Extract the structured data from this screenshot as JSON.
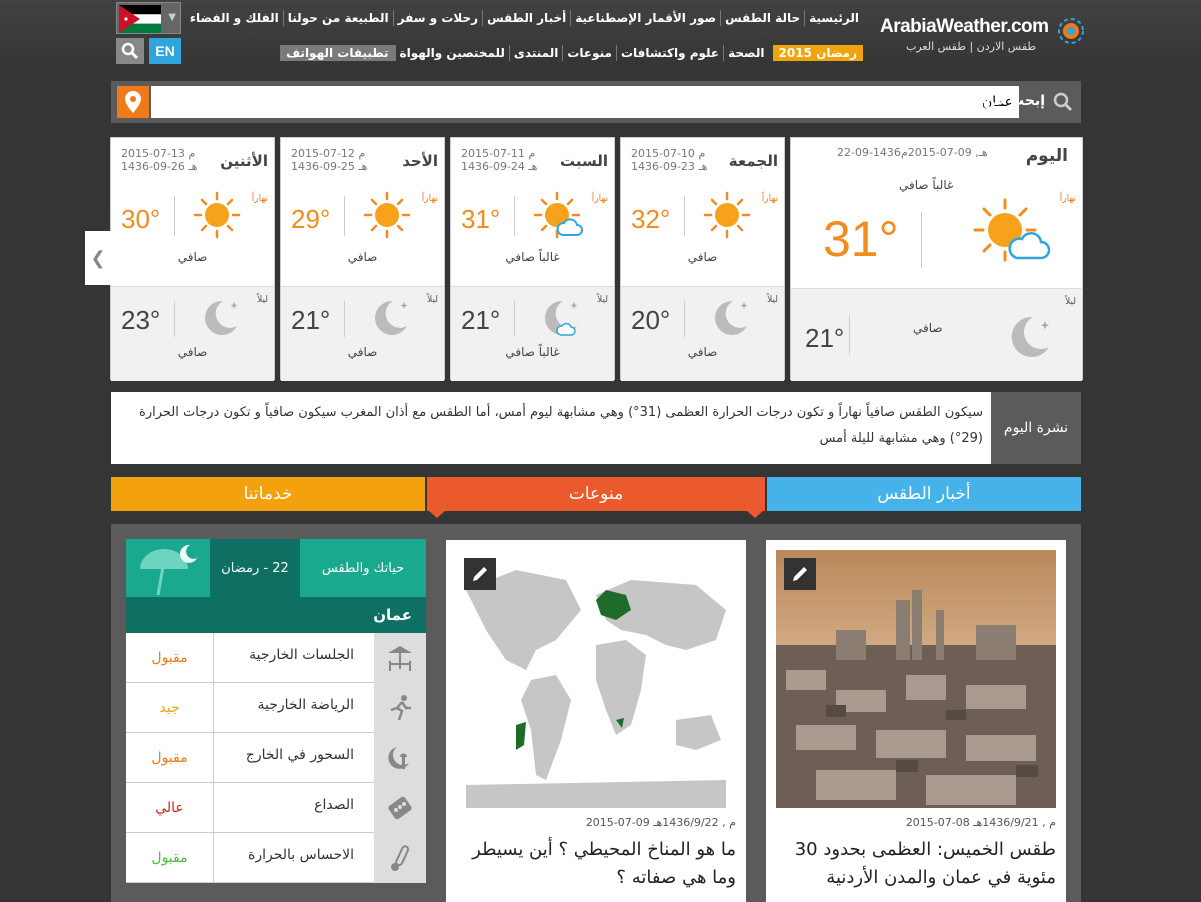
{
  "header": {
    "logo_name": "ArabiaWeather.com",
    "logo_sub": "طقس الاردن | طقس العرب",
    "lang": "EN",
    "nav_primary": [
      "الرئيسية",
      "حالة الطقس",
      "صور الأقمار الإصطناعية",
      "أخبار الطقس",
      "رحلات و سفر",
      "الطبيعة من حولنا",
      "الفلك و الفضاء"
    ],
    "nav_secondary": [
      "رمضان 2015",
      "الصحة",
      "علوم واكتشافات",
      "منوعات",
      "المنتدى",
      "للمختصين والهواة",
      "تطبيقات الهواتف"
    ]
  },
  "search": {
    "label": "إبحث عن منطقتك",
    "value": "عمان"
  },
  "today": {
    "day": "اليوم",
    "date": "22-09-1436هـ, 09-07-2015م",
    "summary": "غالباً صافي",
    "day_label": "نهاراً",
    "temp_day": "31°",
    "night_label": "ليلاً",
    "night_cond": "صافي",
    "temp_night": "21°"
  },
  "forecast": [
    {
      "day": "الجمعة",
      "greg": "2015-07-10 م",
      "hijri": "1436-09-23 هـ",
      "day_label": "نهاراً",
      "temp_day": "32°",
      "cond_day": "صافي",
      "night_label": "ليلاً",
      "temp_night": "20°",
      "cond_night": "صافي"
    },
    {
      "day": "السبت",
      "greg": "2015-07-11 م",
      "hijri": "1436-09-24 هـ",
      "day_label": "نهاراً",
      "temp_day": "31°",
      "cond_day": "غالباً صافي",
      "night_label": "ليلاً",
      "temp_night": "21°",
      "cond_night": "غالباً صافي"
    },
    {
      "day": "الأحد",
      "greg": "2015-07-12 م",
      "hijri": "1436-09-25 هـ",
      "day_label": "نهاراً",
      "temp_day": "29°",
      "cond_day": "صافي",
      "night_label": "ليلاً",
      "temp_night": "21°",
      "cond_night": "صافي"
    },
    {
      "day": "الأثنين",
      "greg": "2015-07-13 م",
      "hijri": "1436-09-26 هـ",
      "day_label": "نهاراً",
      "temp_day": "30°",
      "cond_day": "صافي",
      "night_label": "ليلاً",
      "temp_night": "23°",
      "cond_night": "صافي"
    }
  ],
  "bulletin": {
    "title": "نشرة اليوم",
    "text": "سيكون الطقس صافياً نهاراً و تكون درجات الحرارة العظمى (31°) وهي مشابهة ليوم أمس، أما الطقس مع أذان المغرب سيكون صافياً و تكون درجات الحرارة (29°) وهي مشابهة لليلة أمس"
  },
  "tabs": {
    "weather": "أخبار الطقس",
    "misc": "منوعات",
    "services": "خدماتنا"
  },
  "news": [
    {
      "date": "2015-07-08 م , 1436/9/21هـ",
      "title": "طقس الخميس: العظمى بحدود 30 مئوية في عمان والمدن الأردنية"
    },
    {
      "date": "2015-07-09 م , 1436/9/22هـ",
      "title": "ما هو المناخ المحيطي ؟ أين يسيطر وما هي صفاته ؟"
    }
  ],
  "life": {
    "title": "حياتك والطقس",
    "ramadan": "22 - رمضان",
    "city": "عمان",
    "rows": [
      {
        "icon": "outdoor-seating-icon",
        "label": "الجلسات الخارجية",
        "value": "مقبول",
        "color": "#f07a1a"
      },
      {
        "icon": "running-icon",
        "label": "الرياضة الخارجية",
        "value": "جيد",
        "color": "#f0a30a"
      },
      {
        "icon": "mosque-crescent-icon",
        "label": "السحور في الخارج",
        "value": "مقبول",
        "color": "#f07a1a"
      },
      {
        "icon": "pills-icon",
        "label": "الصداع",
        "value": "عالي",
        "color": "#d62020"
      },
      {
        "icon": "thermometer-icon",
        "label": "الاحساس بالحرارة",
        "value": "مقبول",
        "color": "#4cbf3a"
      }
    ]
  }
}
